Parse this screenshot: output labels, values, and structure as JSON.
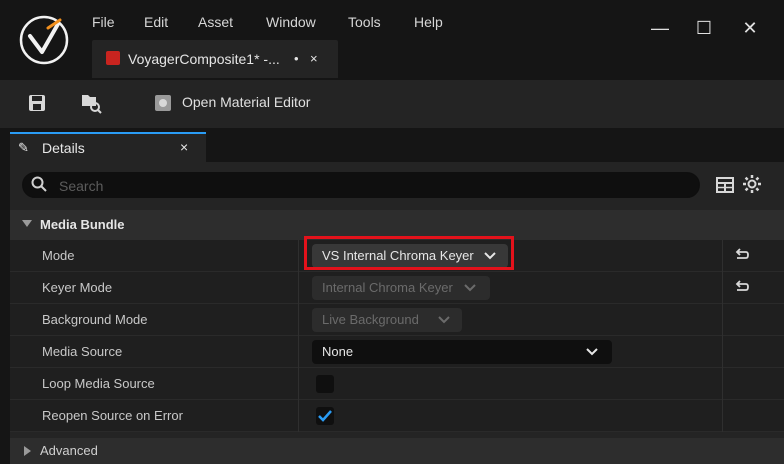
{
  "menu": [
    "File",
    "Edit",
    "Asset",
    "Window",
    "Tools",
    "Help"
  ],
  "document_tab": {
    "title": "VoyagerComposite1* -...",
    "dirty": "•",
    "close": "×"
  },
  "window_buttons": {
    "minimize": "—",
    "maximize": "☐",
    "close": "✕"
  },
  "toolbar": {
    "open_material_editor": "Open Material Editor"
  },
  "details_tab": {
    "label": "Details",
    "close": "×"
  },
  "search": {
    "placeholder": "Search"
  },
  "category": {
    "label": "Media Bundle"
  },
  "rows": [
    {
      "name": "Mode",
      "value": "VS Internal Chroma Keyer",
      "enabled": true,
      "has_reset": true
    },
    {
      "name": "Keyer Mode",
      "value": "Internal Chroma Keyer",
      "enabled": false,
      "has_reset": true
    },
    {
      "name": "Background Mode",
      "value": "Live Background",
      "enabled": false,
      "has_reset": false
    },
    {
      "name": "Media Source",
      "value": "None",
      "enabled": true,
      "has_reset": false
    },
    {
      "name": "Loop Media Source",
      "checked": false
    },
    {
      "name": "Reopen Source on Error",
      "checked": true
    }
  ],
  "advanced": {
    "label": "Advanced"
  },
  "colors": {
    "accent": "#2a9cf5",
    "highlight_box": "#e3121b",
    "background": "#151515",
    "panel": "#242424"
  }
}
